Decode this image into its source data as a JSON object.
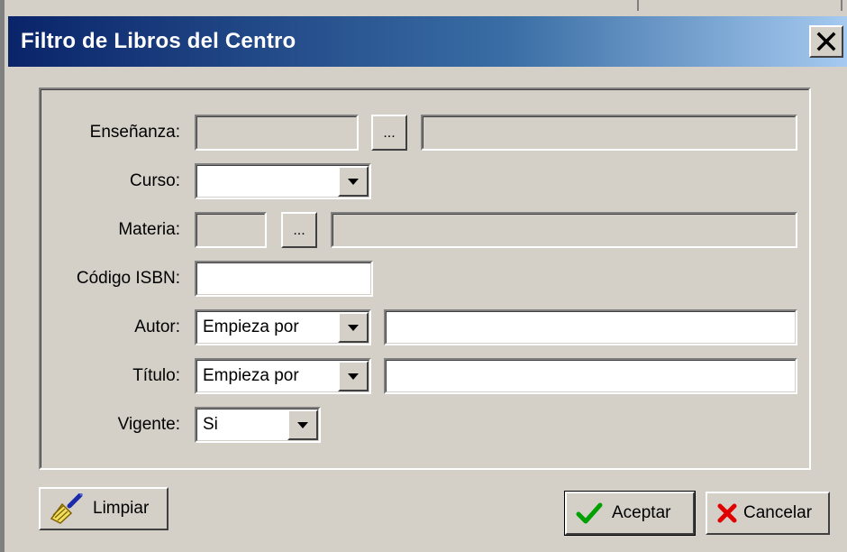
{
  "window": {
    "title": "Filtro de Libros del Centro",
    "close_icon": "close-x-icon"
  },
  "form": {
    "ensenanza": {
      "label": "Enseñanza:",
      "code": "",
      "description": "",
      "browse_label": "..."
    },
    "curso": {
      "label": "Curso:",
      "value": ""
    },
    "materia": {
      "label": "Materia:",
      "code": "",
      "description": "",
      "browse_label": "..."
    },
    "isbn": {
      "label": "Código ISBN:",
      "value": ""
    },
    "autor": {
      "label": "Autor:",
      "mode": "Empieza por",
      "value": ""
    },
    "titulo": {
      "label": "Título:",
      "mode": "Empieza por",
      "value": ""
    },
    "vigente": {
      "label": "Vigente:",
      "value": "Si"
    }
  },
  "buttons": {
    "limpiar": {
      "label": "Limpiar",
      "icon": "broom-icon"
    },
    "aceptar": {
      "label": "Aceptar",
      "icon": "check-icon"
    },
    "cancelar": {
      "label": "Cancelar",
      "icon": "x-cancel-icon"
    }
  },
  "colors": {
    "titlebar_start": "#0a246a",
    "titlebar_end": "#a6caf0",
    "face": "#d4d0c8",
    "check": "#00a000",
    "cancel": "#e00000"
  }
}
